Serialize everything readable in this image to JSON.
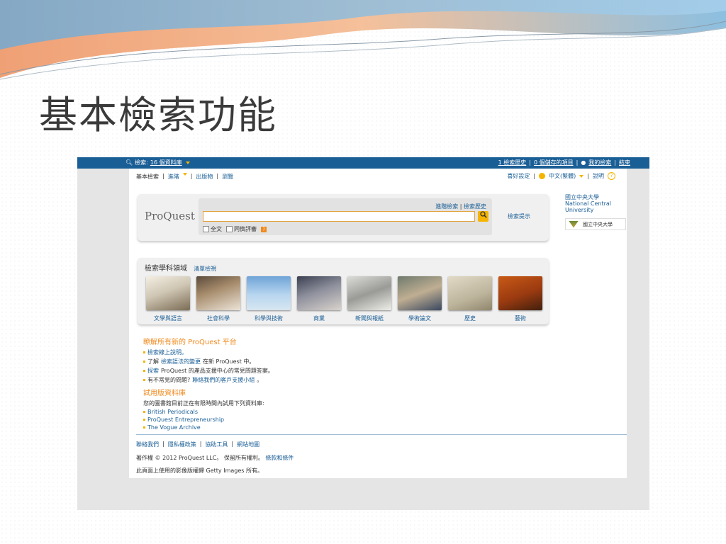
{
  "slide": {
    "title": "基本檢索功能"
  },
  "topbar": {
    "search_label": "檢索:",
    "db_count": "16 個資料庫",
    "history": "1 檢索歷史",
    "saved": "0 個儲存的項目",
    "my_search": "我的檢索",
    "exit": "結束"
  },
  "nav": {
    "basic": "基本檢索",
    "advanced": "進階",
    "publications": "出版物",
    "browse": "瀏覽",
    "preferences": "喜好設定",
    "language": "中文(繁體)",
    "help": "說明"
  },
  "search": {
    "logo": "ProQuest",
    "advanced_link": "進階檢索",
    "history_link": "檢索歷史",
    "input_value": "",
    "fulltext": "全文",
    "peer_reviewed": "同儕評審",
    "tips": "檢索提示"
  },
  "institution": {
    "name_zh": "國立中央大學",
    "name_en": "National Central University",
    "logo_text": "國立中央大學"
  },
  "subjects": {
    "heading": "檢索學科領域",
    "browse_all": "清單檢視",
    "items": [
      {
        "label": "文學與語言"
      },
      {
        "label": "社會科學"
      },
      {
        "label": "科學與技術"
      },
      {
        "label": "商業"
      },
      {
        "label": "新聞與報紙"
      },
      {
        "label": "學術論文"
      },
      {
        "label": "歷史"
      },
      {
        "label": "藝術"
      }
    ]
  },
  "info": {
    "heading1": "瞭解所有新的 ProQuest 平台",
    "line1": "檢索線上說明。",
    "line2_pre": "了解",
    "line2_link": "檢索語法的變更",
    "line2_post": "在新 ProQuest 中。",
    "line3_link": "探索",
    "line3_post": "ProQuest 的產品支援中心的常見問題答案。",
    "line4_pre": "有不常見的問題?",
    "line4_link": "聯絡我們的客戶支援小組",
    "line4_post": "。",
    "heading2": "試用版資料庫",
    "trial_intro": "您的圖書館目前正在有限時間內試用下列資料庫:",
    "trials": [
      "British Periodicals",
      "ProQuest Entrepreneurship",
      "The Vogue Archive"
    ]
  },
  "footer": {
    "contact": "聯絡我們",
    "privacy": "隱私權政策",
    "accessibility": "協助工具",
    "sitemap": "網站地圖",
    "copyright": "著作權 © 2012 ProQuest LLC。 保留所有權利。",
    "terms": "條款和條件",
    "images": "此頁面上使用的影像版權歸 Getty Images 所有。"
  },
  "colors": {
    "topbar": "#1a5e96",
    "link": "#1a5e96",
    "accent": "#f4b400",
    "orange_heading": "#f08a1e"
  }
}
